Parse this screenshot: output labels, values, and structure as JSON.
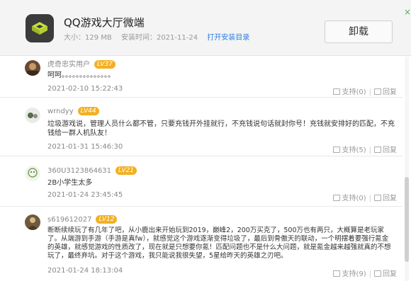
{
  "header": {
    "app_name": "QQ游戏大厅微端",
    "size_label": "大小：129 MB",
    "install_time_label": "安装时间：2021-11-24",
    "open_dir_link": "打开安装目录",
    "uninstall_label": "卸载",
    "close_glyph": "×"
  },
  "comments": [
    {
      "user": "虎奇忠实用户",
      "level": "LV37",
      "text": "呵呵。。。。。。。。。。。。。。",
      "time": "2021-02-10 15:22:43",
      "like_label": "支持(0)",
      "reply_label": "回复"
    },
    {
      "user": "wrndyy",
      "level": "LV44",
      "text": "垃圾游戏说，管理人员什么都不管，只要充钱开外挂就行，不充钱说句话就封你号！充钱就安排好的匹配，不充钱给一群人机队友！",
      "time": "2021-01-31 15:46:30",
      "like_label": "支持(5)",
      "reply_label": "回复"
    },
    {
      "user": "360U3123864631",
      "level": "LV21",
      "text": "2B小学生太多",
      "time": "2021-01-24 23:45:45",
      "like_label": "支持(0)",
      "reply_label": "回复"
    },
    {
      "user": "s619612027",
      "level": "LV12",
      "text": "断断续续玩了有几年了吧，从小鹿出来开始玩到2019，巅峰2，200万买克了，500万也有两只，大概算是老玩家了。从端游到手游（手游是真fw），就感觉这个游戏逐渐变得垃圾了，最后到骨傲天的联动，一个明摆着要强行氪金的英雄，就感觉游戏的性质改了，现在就是只想要你氪！匹配问题也不是什么大问题，就是氪金越来越强就真的不想玩了，最终弃坑。对于这个游戏，我只能说我很失望，5星给昨天的英雄之刃吧。",
      "time": "2021-01-24 18:13:04",
      "like_label": "支持(9)",
      "reply_label": "回复"
    }
  ],
  "colors": {
    "level_badge": "#f3b022",
    "link": "#2b7de1",
    "accent_icon": "#c8e03a"
  }
}
